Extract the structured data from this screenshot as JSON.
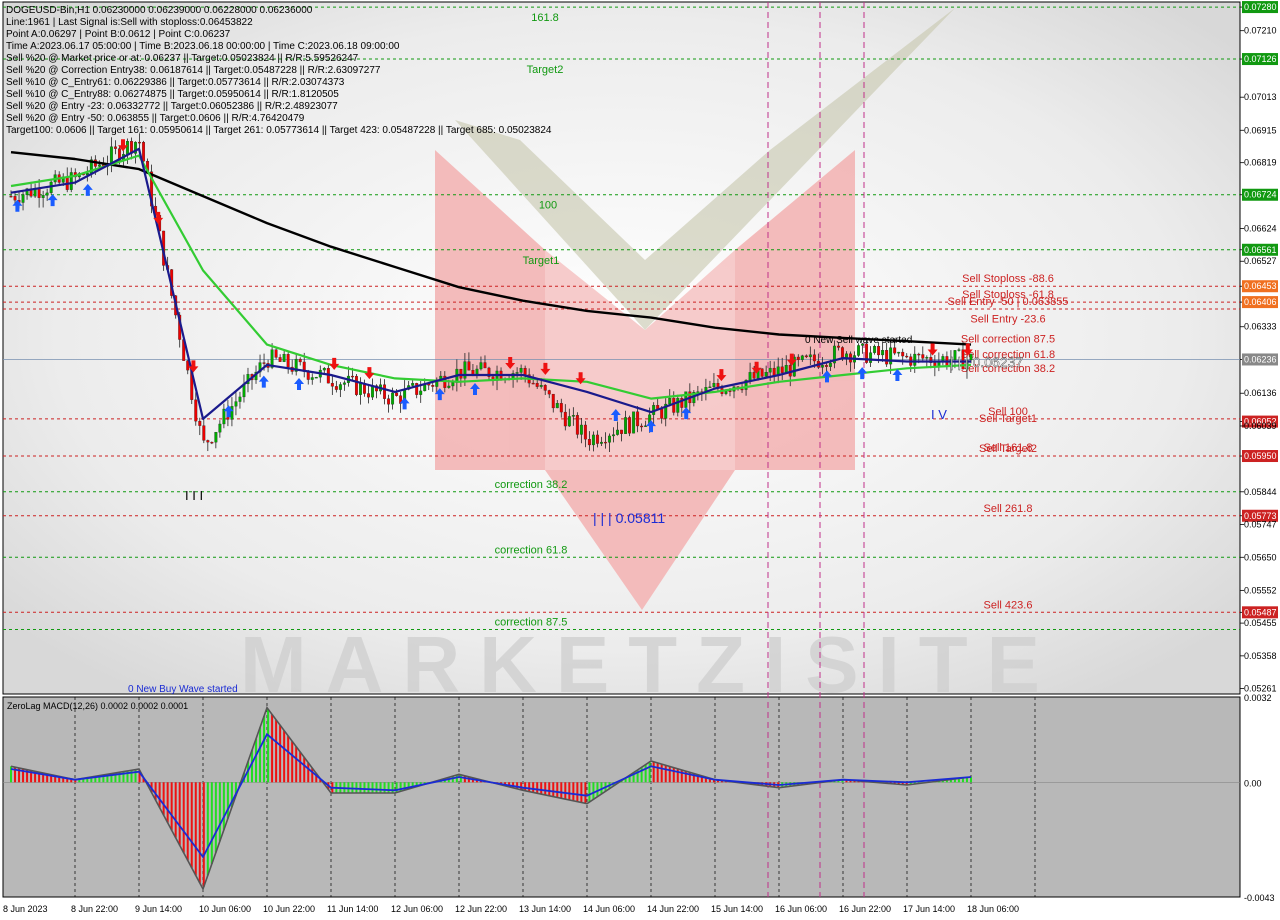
{
  "window": {
    "symbol_line": "DOGEUSD-Bin,H1  0.06230000 0.06239000 0.06228000 0.06236000"
  },
  "info_lines": [
    "Line:1961 | Last Signal is:Sell with stoploss:0.06453822",
    "Point A:0.06297 | Point B:0.0612 | Point C:0.06237",
    "Time A:2023.06.17 05:00:00 | Time B:2023.06.18 00:00:00 | Time C:2023.06.18 09:00:00",
    "Sell %20 @ Market price or at: 0.06237 || Target:0.05023824 || R/R:5.59526247",
    "Sell %20 @ Correction Entry38: 0.06187614 || Target:0.05487228 || R/R:2.63097277",
    "Sell %10 @ C_Entry61: 0.06229386 || Target:0.05773614 || R/R:2.03074373",
    "Sell %10 @ C_Entry88: 0.06274875 || Target:0.05950614 || R/R:1.8120505",
    "Sell %20 @ Entry -23: 0.06332772 || Target:0.06052386 || R/R:2.48923077",
    "Sell %20 @ Entry -50: 0.063855 || Target:0.0606 || R/R:4.76420479",
    "Target100: 0.0606 || Target 161: 0.05950614 || Target 261: 0.05773614 || Target 423: 0.05487228 || Target 685: 0.05023824"
  ],
  "watermark": "MARKETZISITE",
  "colors": {
    "bull": "#00aa00",
    "bear": "#ee0000",
    "ma_black": "#000000",
    "ma_green": "#33cc33",
    "ma_navy": "#1a1a8c",
    "level_red": "#cc2222",
    "level_green": "#119911",
    "macd_signal": "#1a2bd4"
  },
  "price_axis": {
    "ticks": [
      "0.07280",
      "0.07210",
      "0.07126",
      "0.07013",
      "0.06915",
      "0.06819",
      "0.06724",
      "0.06624",
      "0.06561",
      "0.06527",
      "0.06453",
      "0.06406",
      "0.06333",
      "0.06236",
      "0.06136",
      "0.06052",
      "0.06039",
      "0.05950",
      "0.05844",
      "0.05773",
      "0.05747",
      "0.05650",
      "0.05552",
      "0.05487",
      "0.05455",
      "0.05358",
      "0.05261"
    ]
  },
  "time_axis": [
    "8 Jun 2023",
    "8 Jun 22:00",
    "9 Jun 14:00",
    "10 Jun 06:00",
    "10 Jun 22:00",
    "11 Jun 14:00",
    "12 Jun 06:00",
    "12 Jun 22:00",
    "13 Jun 14:00",
    "14 Jun 06:00",
    "14 Jun 22:00",
    "15 Jun 14:00",
    "16 Jun 06:00",
    "16 Jun 22:00",
    "17 Jun 14:00",
    "18 Jun 06:00"
  ],
  "green_levels": [
    {
      "label": "161.8",
      "price": 0.0728
    },
    {
      "label": "Target2",
      "price": 0.07126
    },
    {
      "label": "100",
      "price": 0.06724
    },
    {
      "label": "Target1",
      "price": 0.06561
    },
    {
      "label": "correction 38.2",
      "price": 0.05844
    },
    {
      "label": "correction 61.8",
      "price": 0.0565
    },
    {
      "label": "correction 87.5",
      "price": 0.05436
    }
  ],
  "red_levels": [
    {
      "label": "Sell Stoploss -88.6",
      "price": 0.06453
    },
    {
      "label": "Sell Stoploss -61.8",
      "price": 0.06406
    },
    {
      "label": "Sell Entry -50 | 0.063855",
      "price": 0.063855
    },
    {
      "label": "Sell Entry -23.6",
      "price": 0.06333
    },
    {
      "label": "Sell correction 87.5",
      "price": 0.06274
    },
    {
      "label": "Sell correction 61.8",
      "price": 0.06229
    },
    {
      "label": "Sell correction 38.2",
      "price": 0.06187
    },
    {
      "label": "Sell 100",
      "price": 0.0606
    },
    {
      "label": "Sell Target1",
      "price": 0.06039
    },
    {
      "label": "Sell 161.8",
      "price": 0.05953
    },
    {
      "label": "Sell Target2",
      "price": 0.0595
    },
    {
      "label": "Sell 261.8",
      "price": 0.05773
    },
    {
      "label": "Sell 423.6",
      "price": 0.05487
    }
  ],
  "annotations": {
    "point_c_label": "| | | 0.06237",
    "point_b_label": "| | | 0.05811",
    "iv_label": "I V",
    "triple_bars": "I I I",
    "sell_wave": "0 New Sell wave started",
    "buy_wave": "0 New Buy Wave started"
  },
  "macd": {
    "title": "ZeroLag MACD(12,26) 0.0002 0.0002 0.0001",
    "ticks": [
      "0.0032",
      "0.00",
      "-0.0043"
    ]
  },
  "chart_data": [
    {
      "type": "candlestick",
      "title": "DOGEUSD-Bin,H1",
      "ylim": [
        0.05245,
        0.07295
      ],
      "current_price": 0.06236,
      "x": [
        "8 Jun 2023",
        "8 Jun 22:00",
        "9 Jun 14:00",
        "10 Jun 06:00",
        "10 Jun 22:00",
        "11 Jun 14:00",
        "12 Jun 06:00",
        "12 Jun 22:00",
        "13 Jun 14:00",
        "14 Jun 06:00",
        "14 Jun 22:00",
        "15 Jun 14:00",
        "16 Jun 06:00",
        "16 Jun 22:00",
        "17 Jun 14:00",
        "18 Jun 06:00"
      ],
      "close_approx": [
        0.0672,
        0.0677,
        0.0689,
        0.0598,
        0.0624,
        0.0618,
        0.0612,
        0.062,
        0.062,
        0.06,
        0.0607,
        0.0615,
        0.062,
        0.0626,
        0.0624,
        0.06236
      ],
      "series": [
        {
          "name": "",
          "values": [
            0.0685,
            0.0683,
            0.068,
            0.0672,
            0.0664,
            0.0657,
            0.0651,
            0.0645,
            0.0641,
            0.0638,
            0.0636,
            0.0633,
            0.0631,
            0.063,
            0.0629,
            0.0628
          ]
        },
        {
          "name": "",
          "values": [
            0.0675,
            0.0678,
            0.0684,
            0.065,
            0.0628,
            0.0622,
            0.0618,
            0.0617,
            0.0618,
            0.0617,
            0.0612,
            0.0614,
            0.0617,
            0.0619,
            0.0621,
            0.0622
          ]
        },
        {
          "name": "",
          "values": [
            0.0673,
            0.0676,
            0.0686,
            0.0606,
            0.0622,
            0.0619,
            0.0614,
            0.0619,
            0.0619,
            0.0614,
            0.0608,
            0.0615,
            0.0619,
            0.0624,
            0.0623,
            0.0623
          ]
        }
      ]
    },
    {
      "type": "bar",
      "title": "ZeroLag MACD(12,26) 0.0002 0.0002 0.0001",
      "ylim": [
        -0.0043,
        0.0032
      ],
      "x": [
        "8 Jun 2023",
        "8 Jun 22:00",
        "9 Jun 14:00",
        "10 Jun 06:00",
        "10 Jun 22:00",
        "11 Jun 14:00",
        "12 Jun 06:00",
        "12 Jun 22:00",
        "13 Jun 14:00",
        "14 Jun 06:00",
        "14 Jun 22:00",
        "15 Jun 14:00",
        "16 Jun 06:00",
        "16 Jun 22:00",
        "17 Jun 14:00",
        "18 Jun 06:00"
      ],
      "series": [
        {
          "name": "",
          "values": [
            0.0006,
            0.0001,
            0.0005,
            -0.004,
            0.0028,
            -0.0004,
            -0.0004,
            0.0003,
            -0.0003,
            -0.0008,
            0.0008,
            0.0001,
            -0.0002,
            0.0001,
            -0.0001,
            0.0002
          ]
        },
        {
          "name": "",
          "values": [
            0.0005,
            0.0001,
            0.0004,
            -0.0028,
            0.0018,
            -0.0002,
            -0.0003,
            0.0002,
            -0.0002,
            -0.0005,
            0.0006,
            0.0001,
            -0.0001,
            0.0001,
            0.0,
            0.0002
          ]
        }
      ]
    }
  ]
}
